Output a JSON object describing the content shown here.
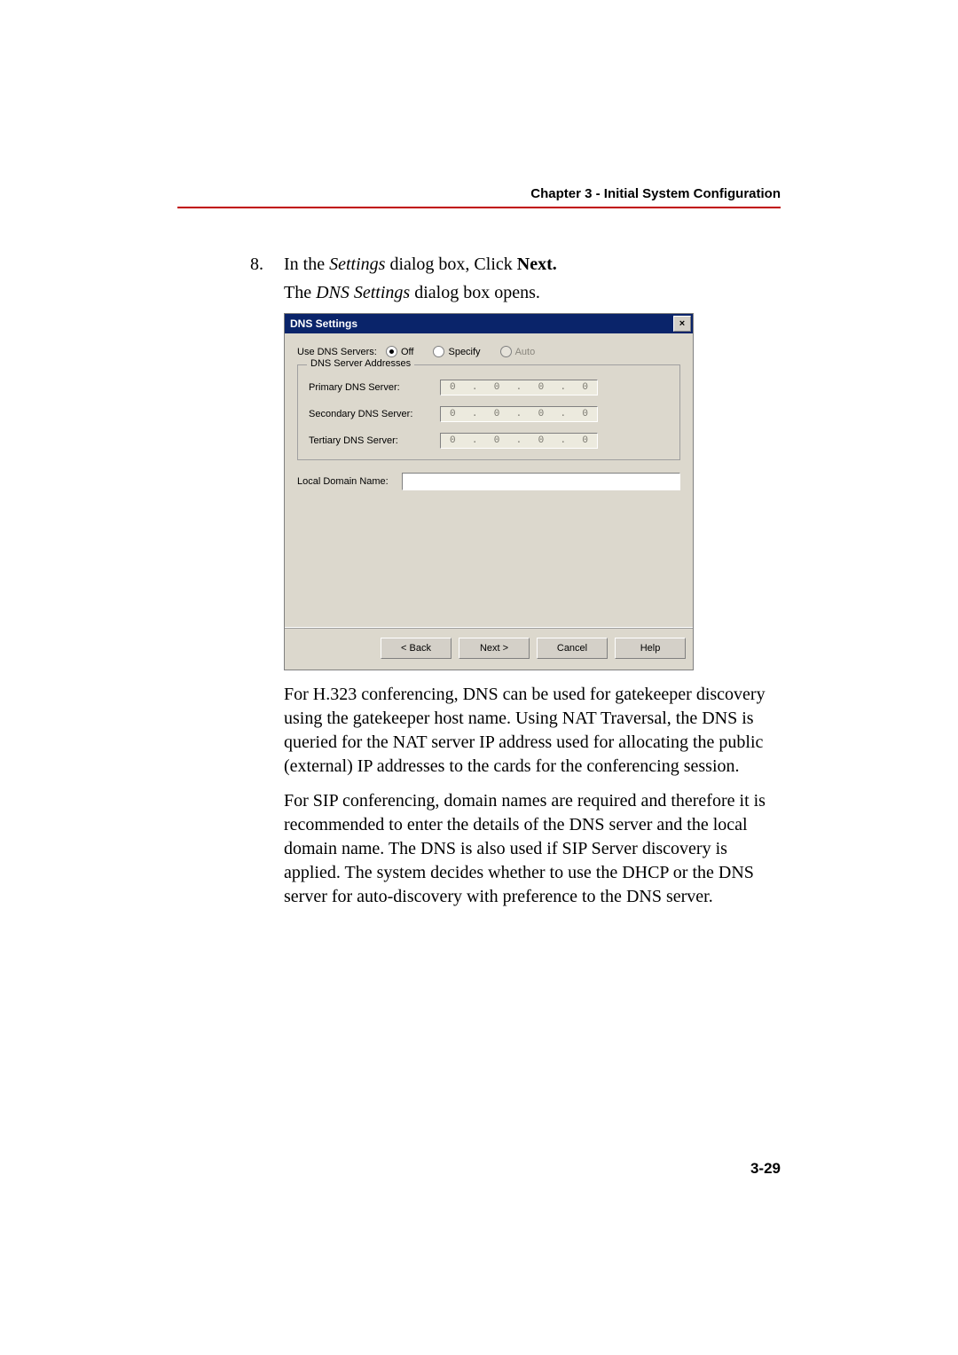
{
  "header": {
    "chapter": "Chapter 3 - Initial System Configuration"
  },
  "step": {
    "number": "8.",
    "pre": "In the ",
    "italic": "Settings",
    "mid": " dialog box, Click ",
    "bold": "Next.",
    "sub_pre": "The ",
    "sub_italic": "DNS Settings",
    "sub_post": " dialog box opens."
  },
  "dialog": {
    "title": "DNS Settings",
    "close_glyph": "×",
    "use_dns_label": "Use DNS Servers:",
    "radio_off": "Off",
    "radio_specify": "Specify",
    "radio_auto": "Auto",
    "groupbox_title": "DNS Server Addresses",
    "primary_label": "Primary DNS Server:",
    "secondary_label": "Secondary DNS Server:",
    "tertiary_label": "Tertiary DNS Server:",
    "ip_octets": [
      "0",
      "0",
      "0",
      "0"
    ],
    "dot": ".",
    "local_domain_label": "Local Domain Name:",
    "local_domain_value": "",
    "buttons": {
      "back": "< Back",
      "next": "Next >",
      "cancel": "Cancel",
      "help": "Help"
    }
  },
  "paragraphs": {
    "p1": "For H.323 conferencing, DNS can be used for gatekeeper discovery using the gatekeeper host name. Using NAT Traversal, the DNS is queried for the NAT server IP address used for allocating the public (external) IP addresses to the cards for the conferencing session.",
    "p2": "For SIP conferencing, domain names are required and therefore it is recommended to enter the details of the DNS server and the local domain name. The DNS is also used if SIP Server discovery is applied. The system decides whether to use the DHCP or the DNS server for auto-discovery with preference to the DNS server."
  },
  "page_number": "3-29"
}
